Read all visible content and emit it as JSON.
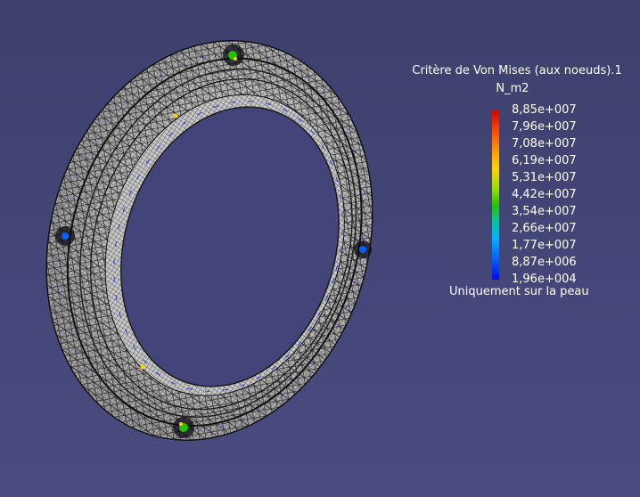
{
  "legend": {
    "title": "Critère de Von Mises (aux noeuds).1",
    "unit": "N_m2",
    "values": [
      "8,85e+007",
      "7,96e+007",
      "7,08e+007",
      "6,19e+007",
      "5,31e+007",
      "4,42e+007",
      "3,54e+007",
      "2,66e+007",
      "1,77e+007",
      "8,87e+006",
      "1,96e+004"
    ],
    "colors": {
      "max": "#d40000",
      "mid": "#22c400",
      "min": "#0008ee"
    },
    "note": "Uniquement sur la peau"
  },
  "viewport": {
    "background": "#42447a",
    "model": "ring-mesh",
    "mesh_color": "#1a1a1a",
    "surface_color": "#d6d6d6"
  }
}
